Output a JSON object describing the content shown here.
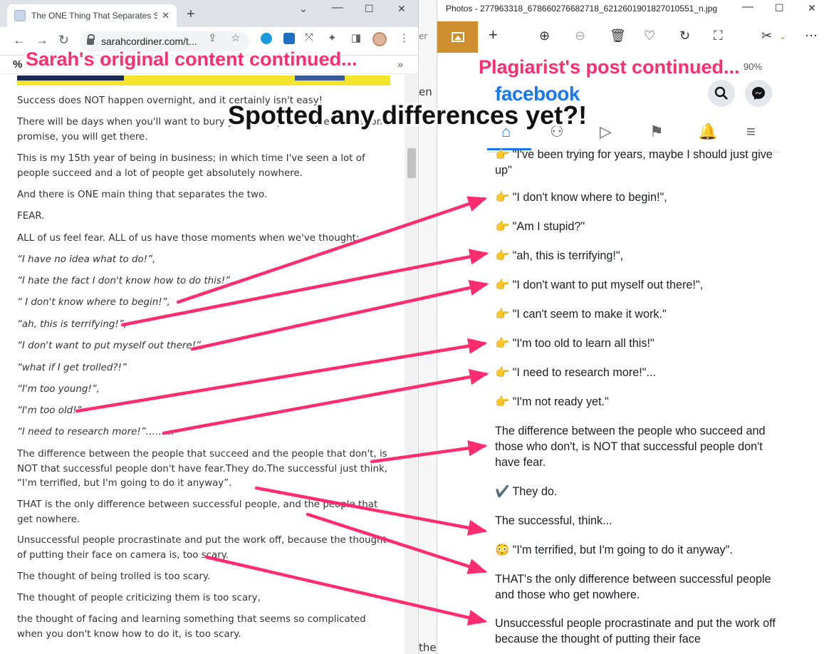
{
  "browser": {
    "tab_title": "The ONE Thing That Separates Su",
    "url": "sarahcordiner.com/t..."
  },
  "article": {
    "paragraphs": [
      {
        "text": "Success does NOT happen overnight, and it certainly isn't easy!",
        "italic": false
      },
      {
        "text": "There will be days when you'll want to bury yo... have just simple dedication, I promise, you will get there.",
        "italic": false
      },
      {
        "text": "This is my 15th year of being in business; in which time I've seen a lot of people succeed and a lot of people get absolutely nowhere.",
        "italic": false
      },
      {
        "text": "And there is ONE main thing that separates the two.",
        "italic": false
      },
      {
        "text": "FEAR.",
        "italic": false
      },
      {
        "text": "ALL of us feel fear. ALL of us have those moments when we've thought;",
        "italic": false
      },
      {
        "text": "“I have no idea what to do!”,",
        "italic": true
      },
      {
        "text": "“I hate the fact I don't know how to do this!”,",
        "italic": true
      },
      {
        "text": "“ I don't know where to begin!”,",
        "italic": true
      },
      {
        "text": "“ah, this is terrifying!”,",
        "italic": true
      },
      {
        "text": "“I don't want to put myself out there!”,",
        "italic": true
      },
      {
        "text": "“what if I get trolled?!”",
        "italic": true
      },
      {
        "text": "“I'm too young!”,",
        "italic": true
      },
      {
        "text": "“I'm too old!”",
        "italic": true
      },
      {
        "text": "“I need to research more!”………",
        "italic": true
      },
      {
        "text": "The difference between the people that succeed and the people that don't, is NOT that successful people don't have fear.They do.The successful just think, “I'm terrified, but I'm going to do it anyway”.",
        "italic": false
      },
      {
        "text": "THAT is the only difference between successful people, and the people that get nowhere.",
        "italic": false
      },
      {
        "text": "Unsuccessful people procrastinate and put the work off, because the thought of putting their face on camera is, too scary.",
        "italic": false
      },
      {
        "text": "The thought of being trolled is too scary.",
        "italic": false
      },
      {
        "text": "The thought of people criticizing them is too scary,",
        "italic": false
      },
      {
        "text": "the thought of facing and learning something that seems so complicated when you don't know how to do it, is too scary.",
        "italic": false
      }
    ]
  },
  "photos": {
    "title": "Photos - 277963318_678660276682718_6212601901827010551_n.jpg",
    "zoom": "90%"
  },
  "facebook": {
    "logo": "facebook",
    "post": {
      "lines": [
        {
          "text": "👉 \"I've been trying for years, maybe I should just give up\""
        },
        {
          "text": "👉 \"I don't know where to begin!\","
        },
        {
          "text": "👉 \"Am I stupid?\""
        },
        {
          "text": "👉 \"ah, this is terrifying!\","
        },
        {
          "text": "👉 \"I don't want to put myself out there!\","
        },
        {
          "text": "👉 \"I can't seem to make it work.\""
        },
        {
          "text": "👉 \"I'm too old to learn all this!\""
        },
        {
          "text": "👉 \"I need to research more!\"..."
        },
        {
          "text": "👉 \"I'm not ready yet.\""
        },
        {
          "text": "The difference between the people who succeed and those who don't, is NOT that successful people don't have fear."
        },
        {
          "text": "✔️ They do."
        },
        {
          "text": "The successful, think..."
        },
        {
          "text": "😳 \"I'm terrified, but I'm going to do it anyway\"."
        },
        {
          "text": "THAT's the only difference between successful people and those who get nowhere."
        },
        {
          "text": "Unsuccessful people procrastinate and put the work off because the thought of putting their face"
        }
      ]
    }
  },
  "background_text": {
    "right_edge_1": "er",
    "right_edge_2": "en",
    "bottom": "the"
  },
  "annotations": {
    "left_caption": "Sarah's original content continued...",
    "right_caption": "Plagiarist's post continued...",
    "center_caption": "Spotted any differences yet?!"
  },
  "colors": {
    "annotation_pink": "#ff2d6f",
    "photos_accent": "#cf8f2e",
    "facebook_blue": "#1877f2"
  }
}
